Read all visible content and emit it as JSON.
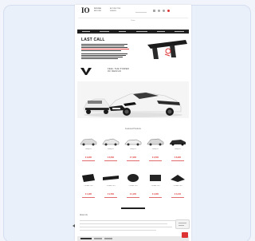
{
  "header": {
    "logo": "IO",
    "logo_text": [
      "IMPERIAL",
      "MOTORS"
    ],
    "tagline": [
      "AUTOMOTIVE",
      "DESIGN"
    ],
    "icons": [
      "search-icon",
      "user-icon",
      "heart-icon",
      "cart-icon"
    ],
    "accent_color": "#d33333"
  },
  "breadcrumb": "Home",
  "banner": {
    "title": "LAST CALL",
    "slogan": [
      "FEEL THE POWER",
      "OF DESIGN"
    ]
  },
  "products_section": {
    "title": "Featured Products"
  },
  "products": [
    {
      "name": "Body Kit",
      "price": "€ 9,900"
    },
    {
      "name": "Body Kit",
      "price": "€ 8,500"
    },
    {
      "name": "Body Kit",
      "price": "€ 7,900"
    },
    {
      "name": "Body Kit",
      "price": "€ 9,500"
    },
    {
      "name": "Body Kit",
      "price": "€ 8,900"
    },
    {
      "name": "Carbon Part",
      "price": "€ 1,900"
    },
    {
      "name": "Carbon Part",
      "price": "€ 2,500"
    },
    {
      "name": "Carbon Part",
      "price": "€ 1,200"
    },
    {
      "name": "Carbon Part",
      "price": "€ 2,900"
    },
    {
      "name": "Carbon Part",
      "price": "€ 3,100"
    }
  ],
  "footer": {
    "title": "About Us"
  }
}
